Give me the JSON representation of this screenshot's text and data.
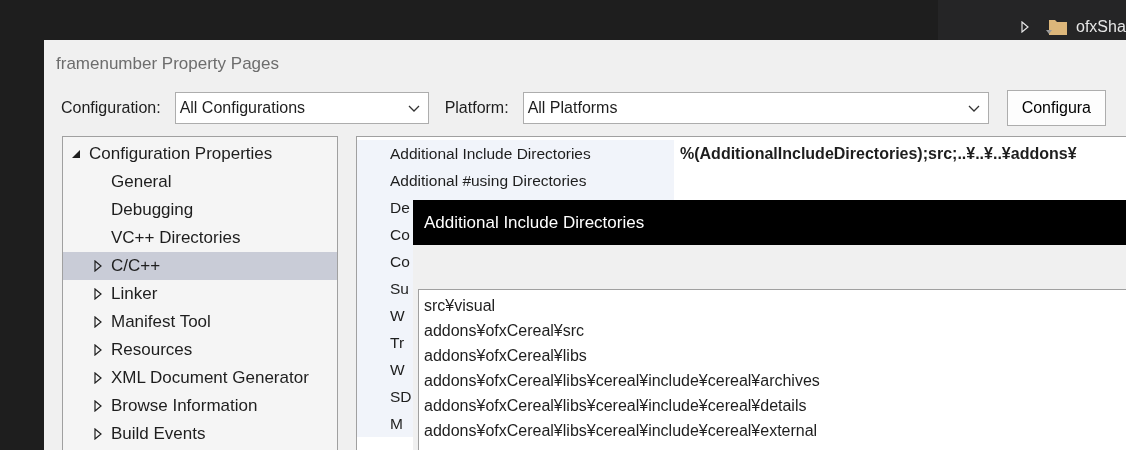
{
  "solution_explorer": {
    "items": [
      {
        "name": "ofxSha",
        "expanded": false
      }
    ]
  },
  "dialog": {
    "title": "framenumber Property Pages",
    "configuration": {
      "label": "Configuration:",
      "value": "All Configurations"
    },
    "platform": {
      "label": "Platform:",
      "value": "All Platforms"
    },
    "config_button": "Configura",
    "tree": [
      {
        "label": "Configuration Properties",
        "expanded": true,
        "selected": false,
        "children": [
          {
            "label": "General",
            "selected": false
          },
          {
            "label": "Debugging",
            "selected": false
          },
          {
            "label": "VC++ Directories",
            "selected": false
          },
          {
            "label": "C/C++",
            "expanded": false,
            "selected": true
          },
          {
            "label": "Linker",
            "expanded": false,
            "selected": false
          },
          {
            "label": "Manifest Tool",
            "expanded": false,
            "selected": false
          },
          {
            "label": "Resources",
            "expanded": false,
            "selected": false
          },
          {
            "label": "XML Document Generator",
            "expanded": false,
            "selected": false
          },
          {
            "label": "Browse Information",
            "expanded": false,
            "selected": false
          },
          {
            "label": "Build Events",
            "expanded": false,
            "selected": false
          }
        ]
      }
    ],
    "properties": [
      {
        "name": "Additional Include Directories",
        "value": "%(AdditionalIncludeDirectories);src;..¥..¥..¥addons¥"
      },
      {
        "name": "Additional #using Directories"
      },
      {
        "name": "De"
      },
      {
        "name": "Co"
      },
      {
        "name": "Co"
      },
      {
        "name": "Su"
      },
      {
        "name": "W"
      },
      {
        "name": "Tr"
      },
      {
        "name": "W"
      },
      {
        "name": "SD"
      },
      {
        "name": "M"
      }
    ]
  },
  "popup": {
    "title": "Additional Include Directories",
    "lines": [
      "src¥visual",
      "addons¥ofxCereal¥src",
      "addons¥ofxCereal¥libs",
      "addons¥ofxCereal¥libs¥cereal¥include¥cereal¥archives",
      "addons¥ofxCereal¥libs¥cereal¥include¥cereal¥details",
      "addons¥ofxCereal¥libs¥cereal¥include¥cereal¥external"
    ]
  }
}
